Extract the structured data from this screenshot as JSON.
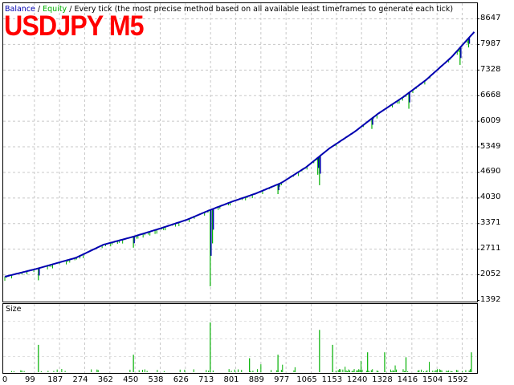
{
  "chart_data": {
    "type": "line",
    "title": "USDJPY M5",
    "legend": {
      "balance": "Balance",
      "equity": "Equity",
      "separator": " / ",
      "method": "Every tick (the most precise method based on all available least timeframes to generate each tick)"
    },
    "colors": {
      "balance": "#0000b0",
      "equity": "#00b000",
      "size": "#00b000",
      "title": "#ff0000",
      "grid": "#c8c8c8"
    },
    "ylim": [
      1392,
      8647
    ],
    "xlim": [
      0,
      1660
    ],
    "y_ticks": [
      "8647",
      "7987",
      "7328",
      "6668",
      "6009",
      "5349",
      "4690",
      "4030",
      "3371",
      "2711",
      "2052",
      "1392"
    ],
    "x_ticks": [
      "0",
      "99",
      "187",
      "274",
      "362",
      "450",
      "538",
      "626",
      "713",
      "801",
      "889",
      "977",
      "1065",
      "1153",
      "1240",
      "1328",
      "1416",
      "1504",
      "1592"
    ],
    "balance": {
      "x": [
        0,
        113,
        250,
        347,
        450,
        545,
        640,
        720,
        800,
        880,
        972,
        1060,
        1141,
        1230,
        1311,
        1400,
        1480,
        1570,
        1650
      ],
      "y": [
        1992,
        2198,
        2480,
        2818,
        3020,
        3232,
        3460,
        3707,
        3930,
        4130,
        4410,
        4820,
        5300,
        5730,
        6188,
        6620,
        7060,
        7650,
        8300
      ]
    },
    "equity_drawdowns": [
      {
        "x": 118,
        "y": 1900
      },
      {
        "x": 452,
        "y": 2740
      },
      {
        "x": 722,
        "y": 1743
      },
      {
        "x": 730,
        "y": 2850
      },
      {
        "x": 960,
        "y": 4120
      },
      {
        "x": 1100,
        "y": 4620
      },
      {
        "x": 1106,
        "y": 4350
      },
      {
        "x": 1290,
        "y": 5800
      },
      {
        "x": 1420,
        "y": 6320
      },
      {
        "x": 1600,
        "y": 7450
      },
      {
        "x": 1630,
        "y": 7900
      }
    ],
    "size_panel": {
      "label": "Size",
      "spikes": [
        {
          "x": 118,
          "v": 0.55
        },
        {
          "x": 452,
          "v": 0.35
        },
        {
          "x": 722,
          "v": 1.0
        },
        {
          "x": 1106,
          "v": 0.85
        },
        {
          "x": 1152,
          "v": 0.55
        },
        {
          "x": 1275,
          "v": 0.4
        },
        {
          "x": 1335,
          "v": 0.4
        },
        {
          "x": 1410,
          "v": 0.3
        },
        {
          "x": 1640,
          "v": 0.4
        },
        {
          "x": 960,
          "v": 0.35
        },
        {
          "x": 860,
          "v": 0.28
        }
      ]
    }
  }
}
